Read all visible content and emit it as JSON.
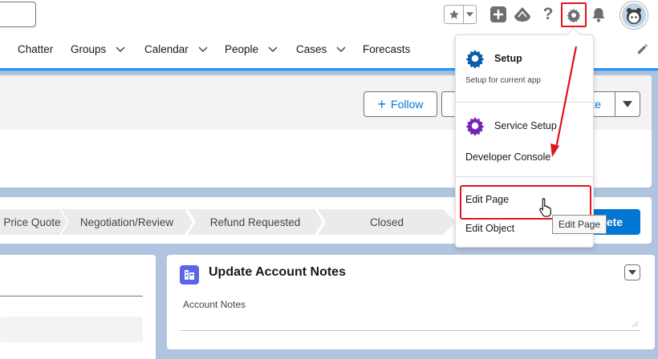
{
  "header": {
    "favorites_star_icon": "star-icon",
    "icons": [
      "add-icon",
      "trailhead-icon",
      "help-icon",
      "setup-gear-icon",
      "notification-bell-icon"
    ],
    "help_glyph": "?"
  },
  "nav": {
    "items": [
      {
        "label": "Chatter",
        "dropdown": false
      },
      {
        "label": "Groups",
        "dropdown": true
      },
      {
        "label": "Calendar",
        "dropdown": true
      },
      {
        "label": "People",
        "dropdown": true
      },
      {
        "label": "Cases",
        "dropdown": true
      },
      {
        "label": "Forecasts",
        "dropdown": false
      }
    ]
  },
  "record": {
    "follow_label": "Follow",
    "partial_button_label": "te"
  },
  "path": {
    "stages": [
      "Price Quote",
      "Negotiation/Review",
      "Refund Requested",
      "Closed"
    ],
    "mark_button_label": "lete"
  },
  "notes_card": {
    "title": "Update Account Notes",
    "field_label": "Account Notes"
  },
  "setup_menu": {
    "setup_title": "Setup",
    "setup_subtitle": "Setup for current app",
    "service_setup": "Service Setup",
    "developer_console": "Developer Console",
    "edit_page": "Edit Page",
    "edit_object": "Edit Object"
  },
  "tooltip": "Edit Page",
  "colors": {
    "brand_blue": "#0176d3",
    "annotation_red": "#e0141e",
    "setup_gear": "#0b5cab",
    "service_gear": "#7526b8"
  }
}
